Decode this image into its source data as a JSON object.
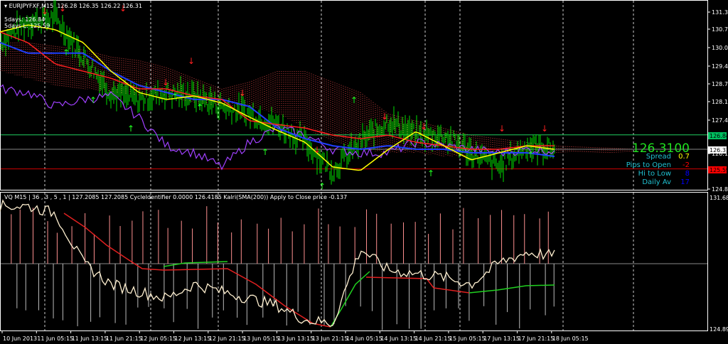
{
  "window": {
    "symbol_header": "EURJPYFXF,M15",
    "ohlc": [
      "126.28",
      "126.35",
      "126.22",
      "126.31"
    ]
  },
  "labels": {
    "five_days_high": "5days: 126.84",
    "five_days_low": "5days L: 125.59"
  },
  "info_panel": {
    "price": "126.3100",
    "rows": [
      {
        "label": "Spread",
        "value": "0.7",
        "color": "#ffff00"
      },
      {
        "label": "Pips to Open",
        "value": "-2",
        "color": "#ff0000"
      },
      {
        "label": "Hi to Low",
        "value": "8",
        "color": "#0000ff"
      },
      {
        "label": "Daily Av",
        "value": "17",
        "color": "#0000ff"
      }
    ]
  },
  "price_axis": {
    "ticks": [
      "131.35",
      "130.70",
      "130.05",
      "129.40",
      "128.75",
      "128.10",
      "127.45",
      "126.15",
      "124.85"
    ],
    "markers": [
      {
        "label": "126.84",
        "bg": "#00c060",
        "fg": "#000"
      },
      {
        "label": "126.31",
        "bg": "#ffffff",
        "fg": "#000"
      },
      {
        "label": "125.59",
        "bg": "#ff0000",
        "fg": "#000"
      }
    ]
  },
  "sub_window": {
    "header": "VQ M15 | 36 , 3 , 5 , 1 | 127.2085 127.2085  CycleIdentifier 0.0000 126.4185  Kalri(SMA(200)) Apply to Close price -0.137",
    "axis_max": "131.6845",
    "axis_min": "124.8905"
  },
  "time_axis": [
    "10 Jun 2013",
    "11 Jun 05:15",
    "11 Jun 13:15",
    "11 Jun 21:15",
    "12 Jun 05:15",
    "12 Jun 13:15",
    "12 Jun 21:15",
    "13 Jun 05:15",
    "13 Jun 13:15",
    "13 Jun 21:15",
    "14 Jun 05:15",
    "14 Jun 13:15",
    "14 Jun 21:15",
    "15 Jun 05:15",
    "17 Jun 13:15",
    "17 Jun 21:15",
    "18 Jun 05:15"
  ],
  "chart_data": {
    "type": "line",
    "title": "EURJPYFXF,M15",
    "series": [
      {
        "name": "price",
        "color": "#00ff00",
        "values": [
          130.23,
          131.01,
          131.14,
          129.71,
          128.4,
          128.14,
          128.4,
          128.27,
          127.88,
          127.62,
          127.22,
          126.57,
          125.53,
          126.57,
          127.36,
          126.83,
          126.83,
          126.18,
          125.66,
          126.44,
          126.31
        ]
      },
      {
        "name": "ma-yellow",
        "color": "#ffff00",
        "values": [
          130.62,
          130.88,
          130.7,
          130.23,
          129.18,
          128.4,
          128.14,
          128.27,
          128.01,
          127.49,
          127.0,
          126.57,
          125.66,
          125.53,
          126.3,
          126.96,
          126.44,
          125.92,
          126.18,
          126.44,
          126.31
        ]
      },
      {
        "name": "ma-red",
        "color": "#ff2020",
        "values": [
          130.62,
          130.23,
          129.44,
          129.18,
          128.92,
          128.53,
          128.53,
          128.27,
          128.14,
          127.36,
          127.22,
          127.09,
          126.83,
          126.7,
          126.83,
          126.57,
          126.44,
          126.31,
          126.31,
          126.44,
          126.44
        ]
      },
      {
        "name": "ma-blue",
        "color": "#2040ff",
        "values": [
          130.23,
          129.84,
          129.84,
          129.84,
          129.18,
          128.66,
          128.4,
          128.14,
          128.14,
          127.88,
          127.09,
          126.7,
          126.44,
          126.31,
          126.44,
          126.31,
          126.31,
          126.18,
          126.18,
          126.18,
          126.05
        ]
      },
      {
        "name": "lagging-purple",
        "color": "#a040ff",
        "values": [
          128.53,
          128.4,
          127.88,
          128.14,
          128.27,
          127.49,
          126.44,
          126.18,
          125.66,
          126.57,
          127.09,
          126.83,
          126.31,
          126.18,
          126.18,
          126.57,
          126.44,
          126.31,
          126.18,
          126.31,
          126.26
        ]
      },
      {
        "name": "cloud-top",
        "color": "#ff8080",
        "values": [
          130.23,
          130.23,
          130.1,
          129.97,
          129.71,
          129.58,
          129.32,
          128.92,
          128.53,
          128.79,
          129.18,
          129.18,
          128.79,
          128.4,
          127.62,
          127.36,
          127.09,
          126.83,
          126.7,
          126.57,
          126.44
        ]
      },
      {
        "name": "cloud-bottom",
        "color": "#ffffff",
        "values": [
          129.18,
          128.92,
          128.66,
          128.53,
          128.4,
          128.27,
          128.27,
          128.01,
          127.88,
          127.88,
          127.62,
          127.09,
          126.57,
          126.31,
          126.18,
          126.18,
          126.05,
          126.05,
          126.18,
          126.18,
          126.18
        ]
      },
      {
        "name": "vq-white",
        "color": "#fff0d0",
        "values": [
          131.25,
          131.25,
          130.88,
          128.33,
          127.23,
          126.86,
          126.5,
          127.23,
          126.86,
          126.5,
          126.13,
          125.4,
          125.22,
          129.05,
          127.96,
          127.78,
          127.59,
          127.23,
          128.33,
          128.87,
          128.69
        ]
      }
    ],
    "ylim": [
      124.85,
      131.35
    ],
    "horizontal_levels": [
      126.84,
      126.31,
      125.59
    ]
  }
}
